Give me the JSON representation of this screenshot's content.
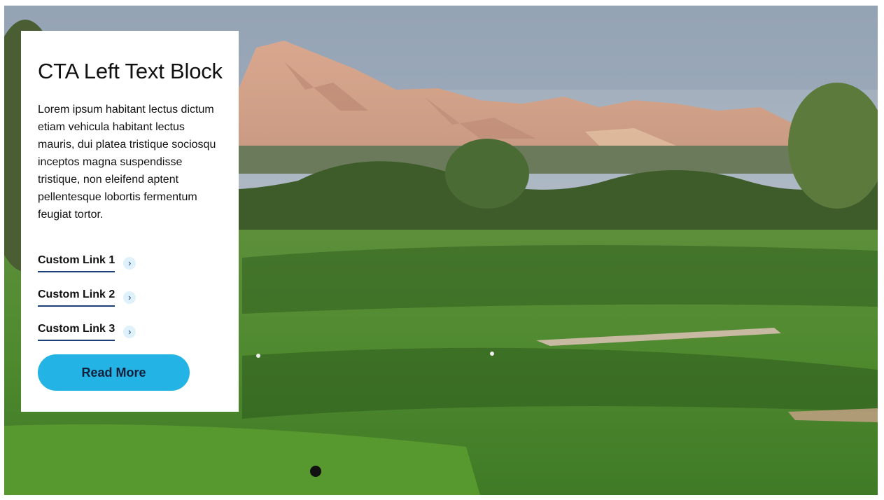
{
  "hero": {
    "image_description_icon": "golf-course-landscape"
  },
  "cta": {
    "title": "CTA Left Text Block",
    "body": "Lorem ipsum habitant lectus dictum etiam vehicula habitant lectus mauris, dui platea tristique sociosqu inceptos magna suspendisse tristique, non eleifend aptent pellentesque lobortis fermentum feugiat tortor.",
    "links": [
      {
        "label": "Custom Link 1"
      },
      {
        "label": "Custom Link 2"
      },
      {
        "label": "Custom Link 3"
      }
    ],
    "button_label": "Read More"
  },
  "colors": {
    "accent": "#23b3e4",
    "link_underline": "#1c3f7a",
    "chevron_bg": "#dff1fb"
  }
}
